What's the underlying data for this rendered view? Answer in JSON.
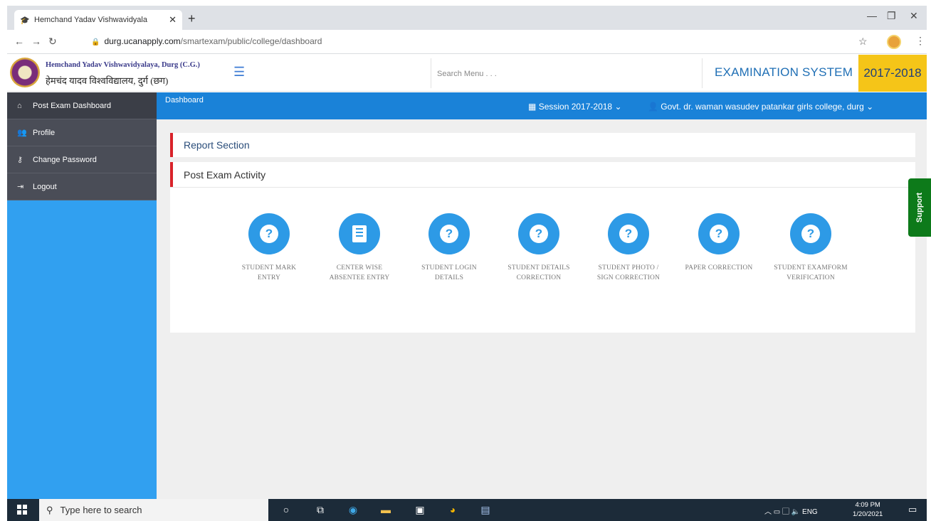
{
  "browser": {
    "tab_title": "Hemchand Yadav Vishwavidyala",
    "new_tab": "+",
    "url_host": "durg.ucanapply.com",
    "url_path": "/smartexam/public/college/dashboard"
  },
  "header": {
    "university_en": "Hemchand Yadav Vishwavidyalaya, Durg (C.G.)",
    "university_hi": "हेमचंद यादव विश्वविद्यालय, दुर्ग (छग)",
    "search_placeholder": "Search Menu . . .",
    "system_title": "EXAMINATION SYSTEM",
    "year": "2017-2018"
  },
  "sidebar": {
    "items": [
      {
        "label": "Post Exam Dashboard",
        "icon": "home-icon"
      },
      {
        "label": "Profile",
        "icon": "users-icon"
      },
      {
        "label": "Change Password",
        "icon": "key-icon"
      },
      {
        "label": "Logout",
        "icon": "sign-out-icon"
      }
    ]
  },
  "topbar": {
    "breadcrumb": "Dashboard",
    "session": "Session  2017-2018",
    "college": "Govt. dr. waman wasudev patankar girls college, durg"
  },
  "sections": {
    "report": "Report Section",
    "post_exam": "Post Exam Activity"
  },
  "activities": [
    {
      "label": "STUDENT MARK ENTRY",
      "icon": "question-icon"
    },
    {
      "label": "CENTER WISE ABSENTEE ENTRY",
      "icon": "clipboard-icon"
    },
    {
      "label": "STUDENT LOGIN DETAILS",
      "icon": "question-icon"
    },
    {
      "label": "STUDENT DETAILS CORRECTION",
      "icon": "question-icon"
    },
    {
      "label": "STUDENT PHOTO / SIGN CORRECTION",
      "icon": "question-icon"
    },
    {
      "label": "PAPER CORRECTION",
      "icon": "question-icon"
    },
    {
      "label": "STUDENT EXAMFORM VERIFICATION",
      "icon": "question-icon"
    }
  ],
  "support_label": "Support",
  "taskbar": {
    "search_placeholder": "Type here to search",
    "lang": "ENG",
    "time": "4:09 PM",
    "date": "1/20/2021"
  },
  "colors": {
    "sidebar_blue": "#31a0f0",
    "topbar_blue": "#1a82d8",
    "accent_red": "#d9232a",
    "year_yellow": "#f5c518",
    "support_green": "#0d7a1a"
  }
}
